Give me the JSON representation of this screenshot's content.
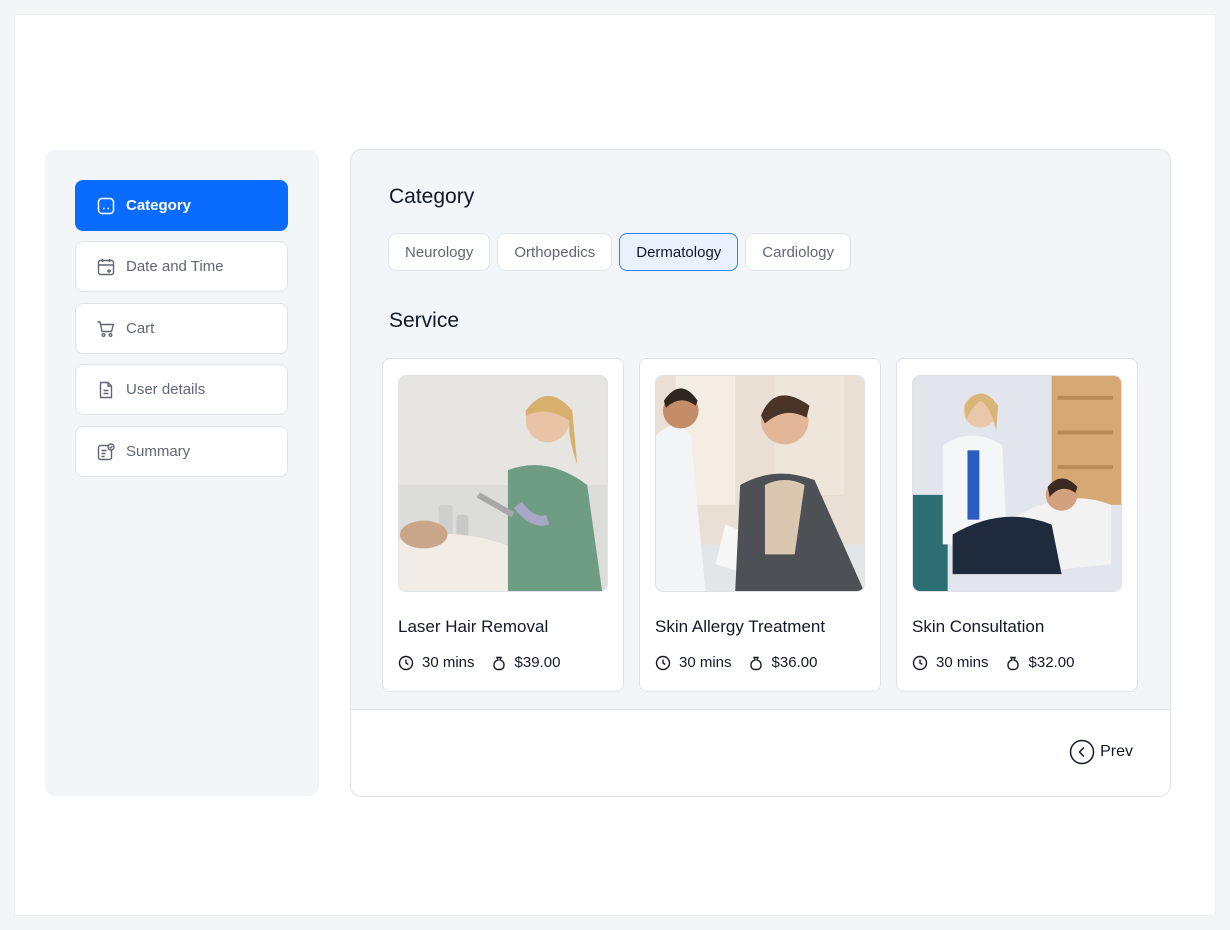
{
  "sidebar": {
    "items": [
      {
        "label": "Category",
        "icon": "category-icon",
        "active": true
      },
      {
        "label": "Date and Time",
        "icon": "calendar-icon",
        "active": false
      },
      {
        "label": "Cart",
        "icon": "cart-icon",
        "active": false
      },
      {
        "label": "User details",
        "icon": "document-icon",
        "active": false
      },
      {
        "label": "Summary",
        "icon": "summary-icon",
        "active": false
      }
    ]
  },
  "main": {
    "category_title": "Category",
    "categories": [
      "Neurology",
      "Orthopedics",
      "Dermatology",
      "Cardiology"
    ],
    "selected_category": "Dermatology",
    "service_title": "Service",
    "services": [
      {
        "title": "Laser Hair Removal",
        "duration": "30 mins",
        "price": "$39.00"
      },
      {
        "title": "Skin Allergy Treatment",
        "duration": "30 mins",
        "price": "$36.00"
      },
      {
        "title": "Skin Consultation",
        "duration": "30 mins",
        "price": "$32.00"
      }
    ],
    "prev_label": "Prev"
  },
  "colors": {
    "accent": "#0a6cff",
    "selected_pill_bg": "#e8f1fc",
    "selected_pill_border": "#2f80ed",
    "panel_bg": "#f3f6f9"
  }
}
